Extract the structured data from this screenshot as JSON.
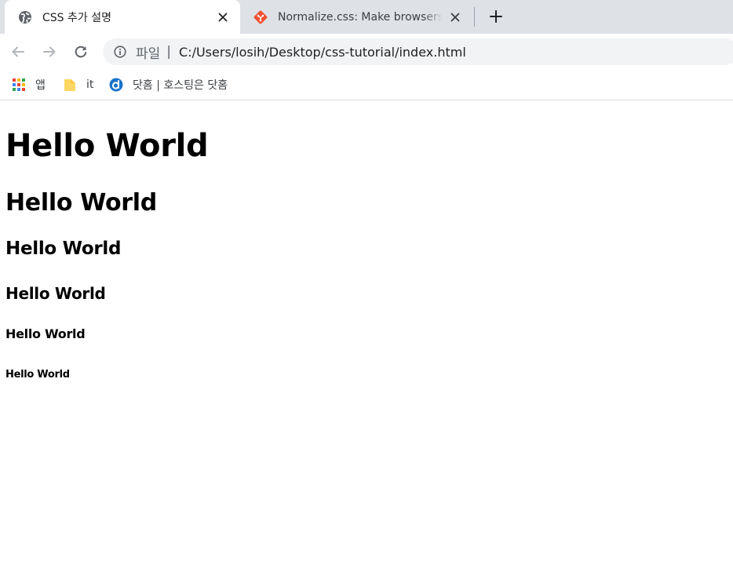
{
  "browser": {
    "tabs": [
      {
        "title": "CSS 추가 설명",
        "active": true,
        "favicon": "globe-icon"
      },
      {
        "title": "Normalize.css: Make browsers render all elements more consistently.",
        "active": false,
        "favicon": "git-diamond-icon"
      }
    ],
    "new_tab_icon": "plus-icon",
    "toolbar": {
      "back_icon": "arrow-left-icon",
      "forward_icon": "arrow-right-icon",
      "reload_icon": "reload-icon"
    },
    "omnibox": {
      "scheme_label": "파일",
      "divider": "|",
      "url": "C:/Users/losih/Desktop/css-tutorial/index.html",
      "info_icon": "info-icon"
    },
    "bookmarks": [
      {
        "label": "앱",
        "icon": "apps-grid-icon"
      },
      {
        "label": "it",
        "icon": "folder-icon"
      },
      {
        "label": "닷홈 | 호스팅은 닷홈",
        "icon": "dothome-icon"
      }
    ]
  },
  "page": {
    "headings": [
      {
        "level": "h1",
        "text": "Hello World"
      },
      {
        "level": "h2",
        "text": "Hello World"
      },
      {
        "level": "h3",
        "text": "Hello World"
      },
      {
        "level": "h4",
        "text": "Hello World"
      },
      {
        "level": "h5",
        "text": "Hello World"
      },
      {
        "level": "h6",
        "text": "Hello World"
      }
    ]
  },
  "colors": {
    "tabstrip": "#dee1e6",
    "omnibox": "#f1f3f4",
    "git_orange": "#f05033",
    "dothome_blue": "#1a73c8"
  }
}
